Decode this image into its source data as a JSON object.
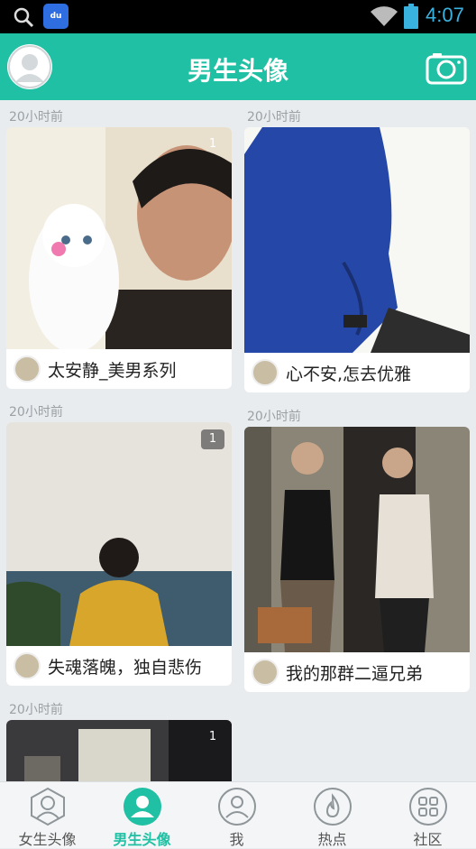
{
  "status_bar": {
    "time": "4:07",
    "app_badge": "du"
  },
  "header": {
    "title": "男生头像"
  },
  "posts": [
    {
      "time": "20小时前",
      "count": "1",
      "name": "太安静_美男系列"
    },
    {
      "time": "20小时前",
      "count": "",
      "name": "心不安,怎去优雅"
    },
    {
      "time": "20小时前",
      "count": "1",
      "name": "失魂落魄，独自悲伤"
    },
    {
      "time": "20小时前",
      "count": "",
      "name": "我的那群二逼兄弟"
    },
    {
      "time": "20小时前",
      "count": "1",
      "name": ""
    }
  ],
  "tabs": [
    {
      "label": "女生头像",
      "icon": "female-avatar-icon"
    },
    {
      "label": "男生头像",
      "icon": "male-avatar-icon"
    },
    {
      "label": "我",
      "icon": "person-icon"
    },
    {
      "label": "热点",
      "icon": "flame-icon"
    },
    {
      "label": "社区",
      "icon": "grid-icon"
    }
  ],
  "colors": {
    "accent": "#1fc0a3",
    "time_text": "#3ab2e0"
  }
}
